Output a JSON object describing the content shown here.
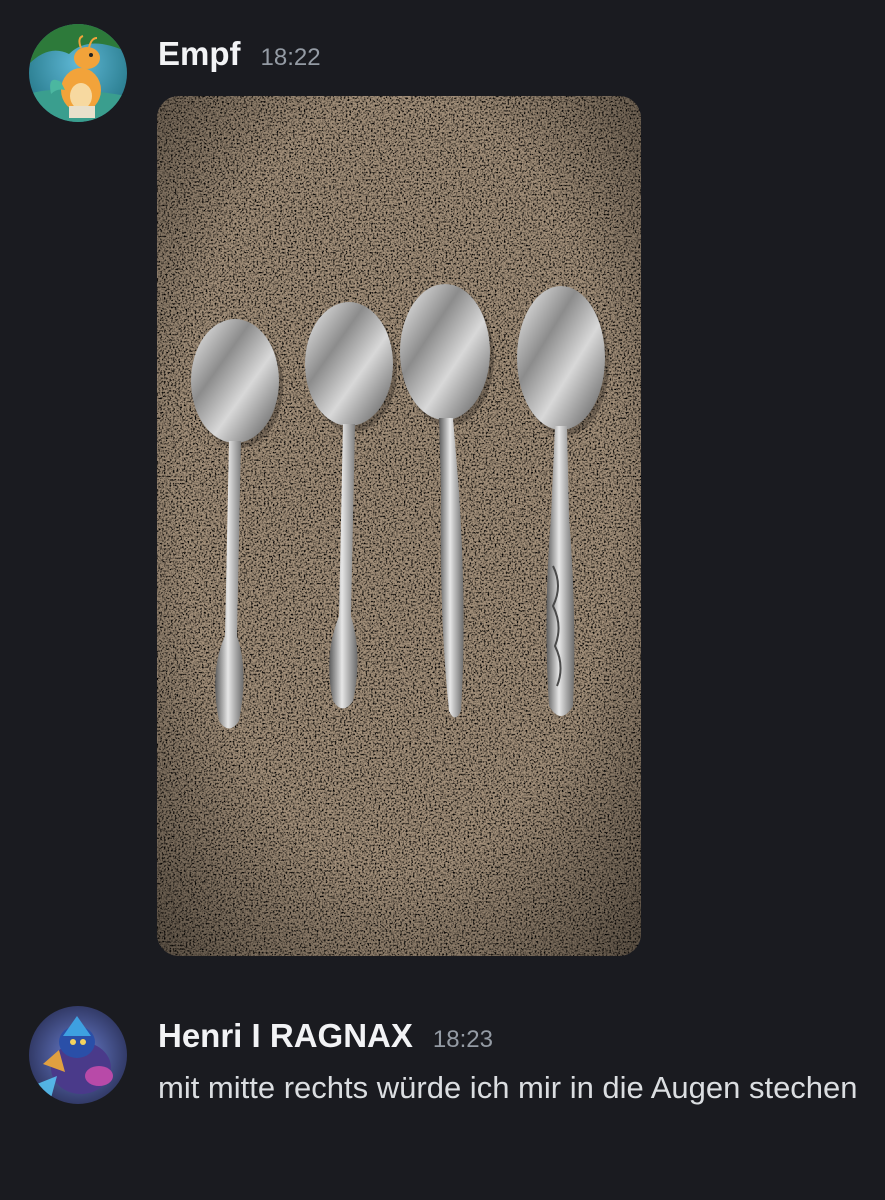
{
  "messages": [
    {
      "username": "Empf",
      "time": "18:22",
      "avatar_icon": "dragon-avatar",
      "attachment": "image-four-spoons-on-granite"
    },
    {
      "username": "Henri I RAGNAX",
      "time": "18:23",
      "avatar_icon": "fantasy-character-avatar",
      "text": "mit mitte rechts würde ich mir in die Augen stechen"
    }
  ],
  "colors": {
    "background": "#1a1b20",
    "username": "#f2f3f5",
    "timestamp": "#949ba4",
    "text": "#dbdee1"
  }
}
